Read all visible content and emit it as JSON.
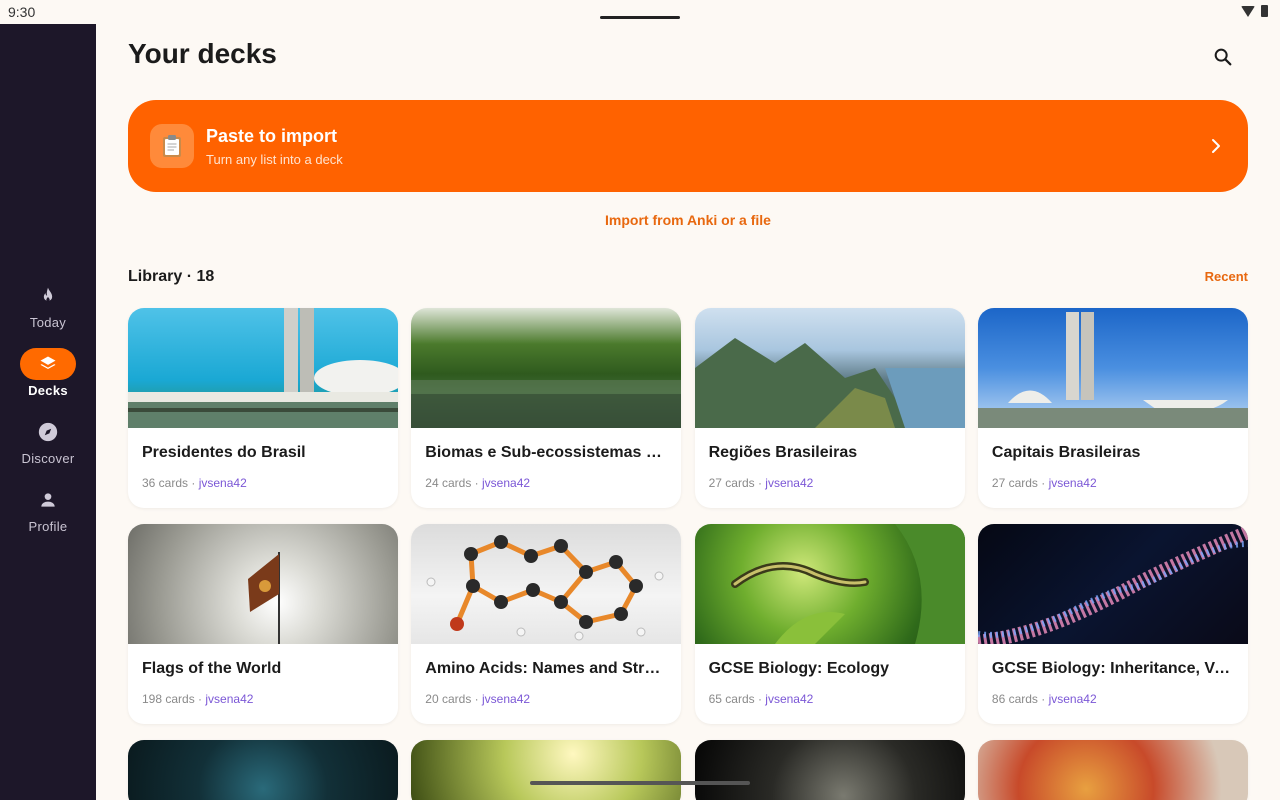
{
  "status": {
    "time": "9:30"
  },
  "nav": {
    "items": [
      {
        "label": "Today",
        "icon": "flame-icon",
        "active": false
      },
      {
        "label": "Decks",
        "icon": "layers-icon",
        "active": true
      },
      {
        "label": "Discover",
        "icon": "compass-icon",
        "active": false
      },
      {
        "label": "Profile",
        "icon": "person-icon",
        "active": false
      }
    ]
  },
  "header": {
    "title": "Your decks",
    "search_icon": "search-icon"
  },
  "import_banner": {
    "icon": "clipboard-icon",
    "title": "Paste to import",
    "subtitle": "Turn any list into a deck"
  },
  "import_link": "Import from Anki or a file",
  "library": {
    "title": "Library · 18",
    "sort_label": "Recent"
  },
  "decks": [
    {
      "title": "Presidentes do Brasil",
      "cards": "36 cards",
      "author": "jvsena42"
    },
    {
      "title": "Biomas e Sub-ecossistemas Brasileiros",
      "cards": "24 cards",
      "author": "jvsena42"
    },
    {
      "title": "Regiões Brasileiras",
      "cards": "27 cards",
      "author": "jvsena42"
    },
    {
      "title": "Capitais Brasileiras",
      "cards": "27 cards",
      "author": "jvsena42"
    },
    {
      "title": "Flags of the World",
      "cards": "198 cards",
      "author": "jvsena42"
    },
    {
      "title": "Amino Acids: Names and Structures",
      "cards": "20 cards",
      "author": "jvsena42"
    },
    {
      "title": "GCSE Biology: Ecology",
      "cards": "65 cards",
      "author": "jvsena42"
    },
    {
      "title": "GCSE Biology: Inheritance, Variation and Evolution",
      "cards": "86 cards",
      "author": "jvsena42"
    }
  ],
  "meta_separator": " · ",
  "colors": {
    "accent": "#ff6200",
    "sidebar": "#1d1729",
    "author": "#7b57d6"
  }
}
